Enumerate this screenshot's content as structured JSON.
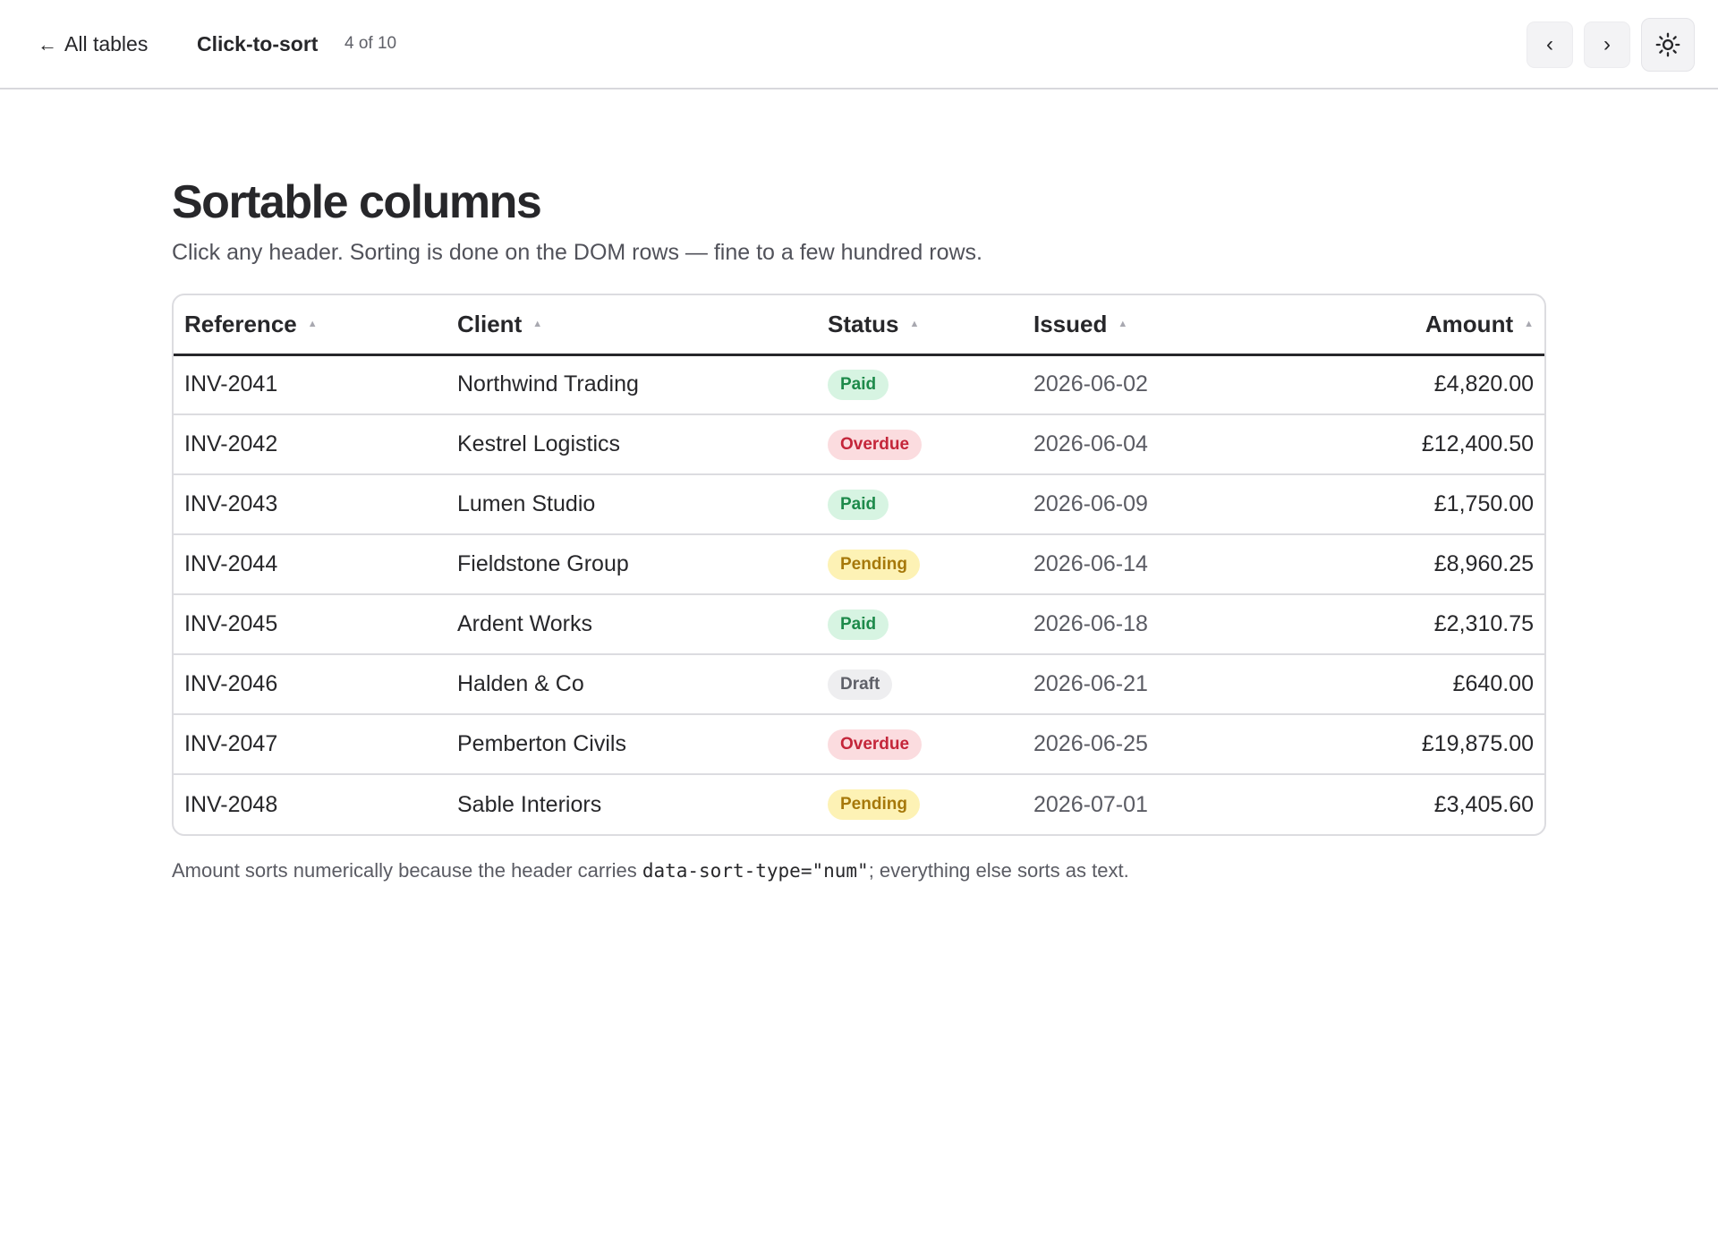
{
  "header": {
    "back_label": "All tables",
    "title": "Click-to-sort",
    "count": "4 of 10",
    "prev_label": "‹",
    "next_label": "›",
    "theme_icon": "sun-icon"
  },
  "main": {
    "title": "Sortable columns",
    "subtitle": "Click any header. Sorting is done on the DOM rows — fine to a few hundred rows.",
    "footnote_before": "Amount sorts numerically because the header carries ",
    "footnote_code": "data-sort-type=\"num\"",
    "footnote_after": "; everything else sorts as text."
  },
  "table": {
    "columns": [
      "Reference",
      "Client",
      "Status",
      "Issued",
      "Amount"
    ],
    "sort_icon": "▲",
    "rows": [
      {
        "reference": "INV-2041",
        "client": "Northwind Trading",
        "status": "Paid",
        "issued": "2026-06-02",
        "amount": "£4,820.00"
      },
      {
        "reference": "INV-2042",
        "client": "Kestrel Logistics",
        "status": "Overdue",
        "issued": "2026-06-04",
        "amount": "£12,400.50"
      },
      {
        "reference": "INV-2043",
        "client": "Lumen Studio",
        "status": "Paid",
        "issued": "2026-06-09",
        "amount": "£1,750.00"
      },
      {
        "reference": "INV-2044",
        "client": "Fieldstone Group",
        "status": "Pending",
        "issued": "2026-06-14",
        "amount": "£8,960.25"
      },
      {
        "reference": "INV-2045",
        "client": "Ardent Works",
        "status": "Paid",
        "issued": "2026-06-18",
        "amount": "£2,310.75"
      },
      {
        "reference": "INV-2046",
        "client": "Halden & Co",
        "status": "Draft",
        "issued": "2026-06-21",
        "amount": "£640.00"
      },
      {
        "reference": "INV-2047",
        "client": "Pemberton Civils",
        "status": "Overdue",
        "issued": "2026-06-25",
        "amount": "£19,875.00"
      },
      {
        "reference": "INV-2048",
        "client": "Sable Interiors",
        "status": "Pending",
        "issued": "2026-07-01",
        "amount": "£3,405.60"
      }
    ]
  },
  "colors": {
    "paid_bg": "#d7f4e2",
    "paid_fg": "#1d8a4a",
    "overdue_bg": "#fbdcdf",
    "overdue_fg": "#c4263a",
    "pending_bg": "#fdf2b5",
    "pending_fg": "#a6780a",
    "draft_bg": "#eeeef0",
    "draft_fg": "#5f6068"
  }
}
